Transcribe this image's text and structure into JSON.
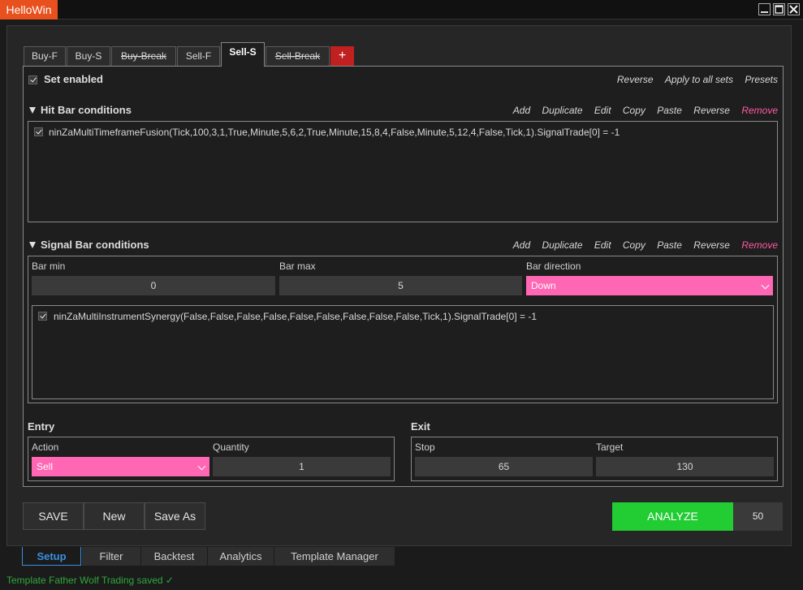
{
  "window": {
    "title": "HelloWin"
  },
  "tabs": [
    {
      "label": "Buy-F",
      "strike": false
    },
    {
      "label": "Buy-S",
      "strike": false
    },
    {
      "label": "Buy-Break",
      "strike": true
    },
    {
      "label": "Sell-F",
      "strike": false
    },
    {
      "label": "Sell-S",
      "strike": false,
      "active": true
    },
    {
      "label": "Sell-Break",
      "strike": true
    },
    {
      "label": "+"
    }
  ],
  "set": {
    "enabled_label": "Set enabled",
    "enabled": true,
    "actions": [
      "Reverse",
      "Apply to all sets",
      "Presets"
    ]
  },
  "hit_bar": {
    "title": "Hit Bar conditions",
    "actions": [
      "Add",
      "Duplicate",
      "Edit",
      "Copy",
      "Paste",
      "Reverse",
      "Remove"
    ],
    "conditions": [
      {
        "checked": true,
        "text": "ninZaMultiTimeframeFusion(Tick,100,3,1,True,Minute,5,6,2,True,Minute,15,8,4,False,Minute,5,12,4,False,Tick,1).SignalTrade[0] = -1"
      }
    ]
  },
  "signal_bar": {
    "title": "Signal Bar conditions",
    "actions": [
      "Add",
      "Duplicate",
      "Edit",
      "Copy",
      "Paste",
      "Reverse",
      "Remove"
    ],
    "bar_min_label": "Bar min",
    "bar_min": "0",
    "bar_max_label": "Bar max",
    "bar_max": "5",
    "bar_direction_label": "Bar direction",
    "bar_direction": "Down",
    "conditions": [
      {
        "checked": true,
        "text": "ninZaMultiInstrumentSynergy(False,False,False,False,False,False,False,False,False,Tick,1).SignalTrade[0] = -1"
      }
    ]
  },
  "entry": {
    "title": "Entry",
    "action_label": "Action",
    "action": "Sell",
    "quantity_label": "Quantity",
    "quantity": "1"
  },
  "exit": {
    "title": "Exit",
    "stop_label": "Stop",
    "stop": "65",
    "target_label": "Target",
    "target": "130"
  },
  "buttons": {
    "save": "SAVE",
    "new": "New",
    "save_as": "Save As",
    "analyze": "ANALYZE",
    "analyze_count": "50"
  },
  "bottom_tabs": [
    {
      "label": "Setup",
      "active": true
    },
    {
      "label": "Filter"
    },
    {
      "label": "Backtest"
    },
    {
      "label": "Analytics"
    },
    {
      "label": "Template Manager"
    }
  ],
  "status": {
    "text": "Template Father Wolf Trading saved ✓"
  },
  "colors": {
    "accent_pink": "#ff66b3",
    "analyze_green": "#22cc33",
    "title_orange": "#e8501e",
    "remove_pink": "#ff5aa5",
    "status_green": "#2fa83a",
    "active_tab_blue": "#3a8fe0"
  }
}
